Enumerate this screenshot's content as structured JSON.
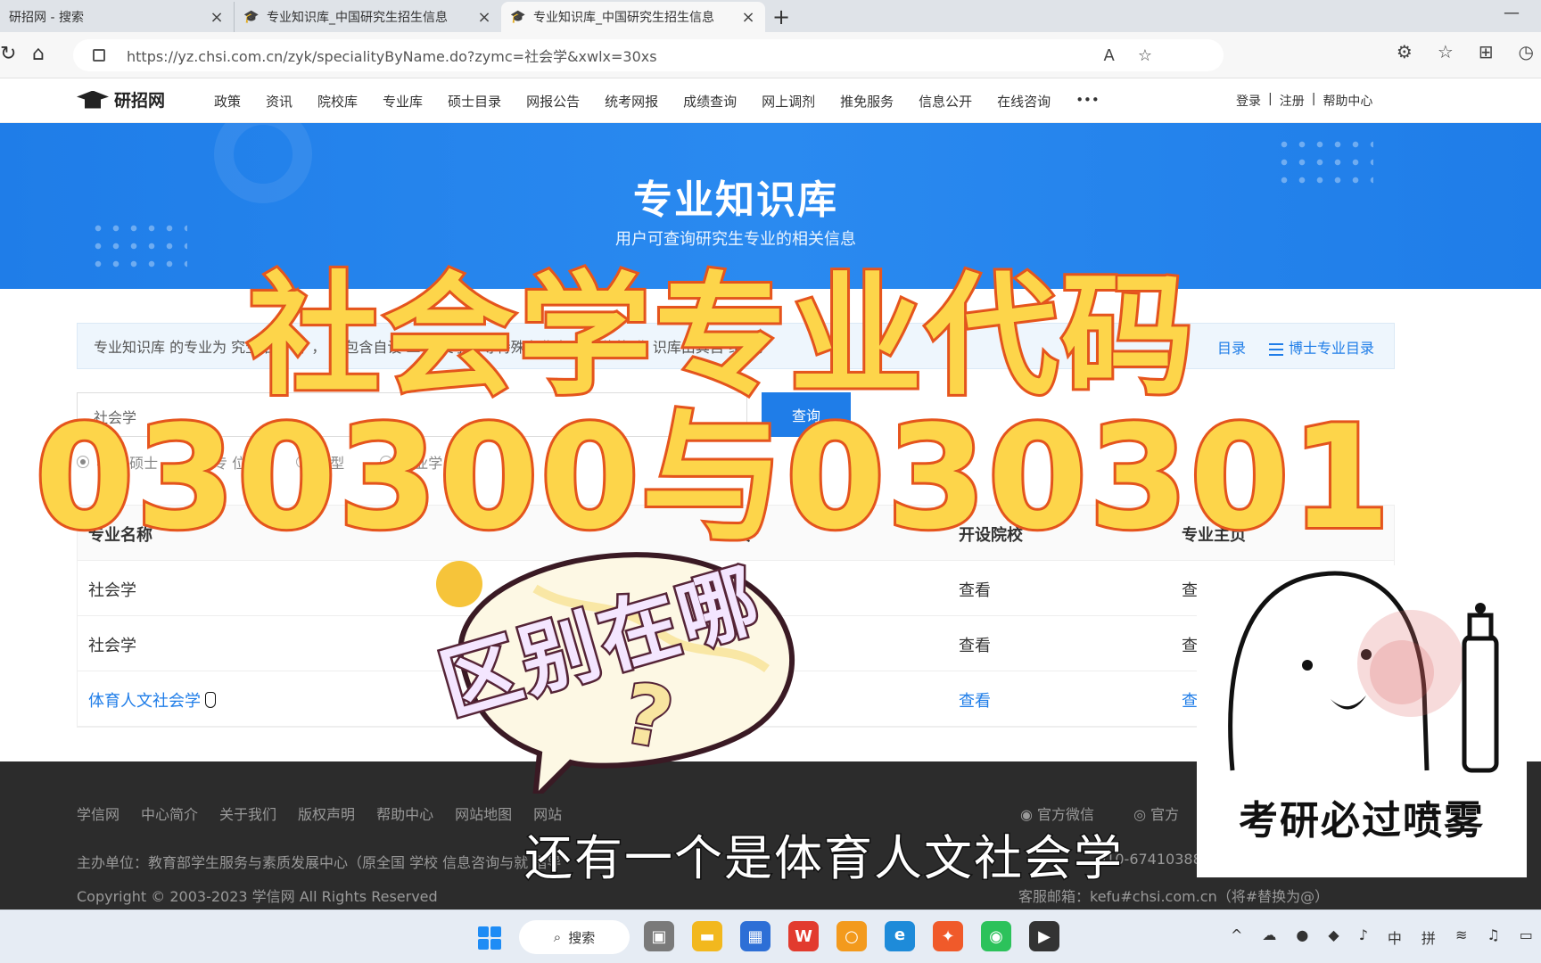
{
  "browser": {
    "tabs": [
      {
        "title": "研招网 - 搜索"
      },
      {
        "title": "专业知识库_中国研究生招生信息"
      },
      {
        "title": "专业知识库_中国研究生招生信息"
      }
    ],
    "url": "https://yz.chsi.com.cn/zyk/specialityByName.do?zymc=社会学&xwlx=30xs"
  },
  "site": {
    "logo": "研招网",
    "nav": [
      "政策",
      "资讯",
      "院校库",
      "专业库",
      "硕士目录",
      "网报公告",
      "统考网报",
      "成绩查询",
      "网上调剂",
      "推免服务",
      "信息公开",
      "在线咨询",
      "•••"
    ],
    "auth": {
      "login": "登录",
      "sep": "|",
      "register": "注册",
      "help": "帮助中心"
    }
  },
  "banner": {
    "title": "专业知识库",
    "subtitle": "用户可查询研究生专业的相关信息"
  },
  "notice": {
    "text": "专业知识库 的专业为 究生招生 专 ， 不包含自设 二 交叉学科等特殊专业 招生单位的 业 识库由其自 维护。",
    "link_masters": "目录",
    "link_phd": "博士专业目录"
  },
  "search": {
    "value": "社会学",
    "button": "查询",
    "radios": [
      {
        "label": "学术 硕士",
        "checked": true
      },
      {
        "label": "专 位硕 ",
        "checked": false
      },
      {
        "label": "术型 ",
        "checked": false
      },
      {
        "label": "专业学 博",
        "checked": false
      }
    ]
  },
  "table": {
    "headers": [
      "专业名称",
      "专",
      "开设院校",
      "专业主页"
    ],
    "rows": [
      {
        "name": "社会学",
        "code": "",
        "schools": "查看",
        "home": "查"
      },
      {
        "name": "社会学",
        "code": "",
        "schools": "查看",
        "home": "查"
      },
      {
        "name": "体育人文社会学",
        "code": "",
        "schools": "查看",
        "home": "查"
      }
    ]
  },
  "footer": {
    "links": [
      "学信网",
      "中心简介",
      "关于我们",
      "版权声明",
      "帮助中心",
      "网站地图",
      "网站"
    ],
    "social": [
      "官方微信",
      "官方"
    ],
    "sponsor": "主办单位：教育部学生服务与素质发展中心（原全国 学校 信息咨询与就 指导",
    "phone": "010-67410388",
    "copyright": "Copyright © 2003-2023 学信网 All Rights Reserved",
    "email": "客服邮箱：kefu#chsi.com.cn（将#替换为@）"
  },
  "taskbar": {
    "search": "搜索",
    "tray": [
      "中",
      "拼"
    ]
  },
  "overlay": {
    "title_line1": "社会学专业代码",
    "title_line2": "030300与030301",
    "bubble": "区别在哪",
    "bubble_q": "?",
    "subtitle": "还有一个是体育人文社会学",
    "sticker": "考研必过喷雾"
  },
  "colors": {
    "brand_blue": "#1f7de8",
    "title_fill": "#fdd54a",
    "title_stroke": "#e8571f"
  }
}
